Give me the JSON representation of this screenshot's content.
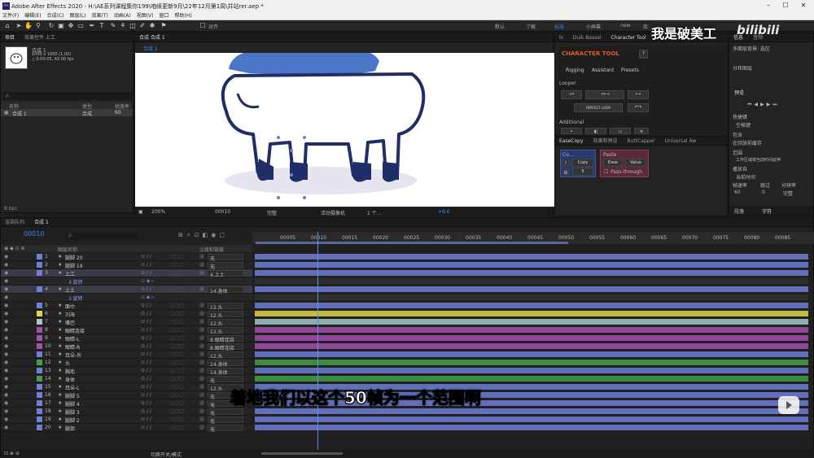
{
  "app": {
    "title": "Adobe After Effects 2020 - H:\\AE系列课程集你199\\咱续更新9月\\22年12月第1周\\并站rer.aep *",
    "logo": "Ae"
  },
  "menu": [
    "文件(F)",
    "编辑(E)",
    "合成(C)",
    "图层(L)",
    "效果(T)",
    "动画(A)",
    "视图(V)",
    "窗口",
    "帮助(H)"
  ],
  "toolbar": {
    "align": "对齐",
    "workspaces": [
      "默认",
      "了解",
      "标准",
      "小屏幕",
      "new",
      "库"
    ],
    "ws_active": "标准"
  },
  "project": {
    "tabs": [
      "项目",
      "效果控件 上工"
    ],
    "comp_name": "合成 1",
    "comp_size": "1000 x 1000 (1.00)",
    "comp_dur": "△ 0:00:05, 60.00 fps",
    "search_placeholder": "ρ.",
    "cols": [
      "名称",
      "类型",
      "帧速率"
    ],
    "item_name": "合成 1",
    "item_type": "合成",
    "item_fps": "60"
  },
  "footer_left": "8 bpc",
  "comp": {
    "tab": "合成 合成 1",
    "sub_tab": "合成 1",
    "zoom": "200%",
    "timecode": "00010",
    "quality": "完整",
    "camera": "活动摄像机",
    "views": "1 个...",
    "exposure": "+0.0"
  },
  "plugins": {
    "tabs": [
      "ls",
      "Duik Bassel",
      "Character Tool"
    ],
    "ct_title": "CHARACTER TOOL",
    "ct_help": "?",
    "ct_tabs": [
      "Rigging",
      "Assistant",
      "Presets"
    ],
    "looper": "Looper",
    "perfect_loop": "PERFECT LOOP",
    "additional": "Additional"
  },
  "easecopy": {
    "tabs": [
      "EaseCopy",
      "效果和预设",
      "ButtCapper",
      "Universal Aw"
    ],
    "copy": "Co...",
    "copy_btn": "Copy",
    "paste": "Paste",
    "ease_btn": "Ease",
    "value_btn": "Value",
    "pass": "Pass-through",
    "num": "5"
  },
  "right_panel": {
    "tabs": [
      "信息",
      "音频"
    ],
    "fields": [
      "多面层背景: 选区",
      "分布图层"
    ],
    "preview": "预览",
    "shortcut": "快捷键",
    "space": "空格键",
    "include": "包含",
    "loop_check": "在回放前缓存",
    "range": "范围",
    "range_val": "工作区域按当前时间延伸",
    "play_from": "播放自",
    "play_val": "当前时间",
    "fps": "帧速率",
    "skip": "跳过",
    "res": "分辨率",
    "fps_val": "60",
    "skip_val": "0",
    "res_val": "完整",
    "bottom_tabs": [
      "段落",
      "字符"
    ]
  },
  "timeline": {
    "tabs": [
      "渲染队列",
      "合成 1"
    ],
    "time": "00010",
    "search_placeholder": "ρ.",
    "col_name": "图层名称",
    "col_parent": "父级和链接",
    "ruler": [
      "00005",
      "00010",
      "00015",
      "00020",
      "00025",
      "00030",
      "00035",
      "00040",
      "00045",
      "00050",
      "00055",
      "00060",
      "00065",
      "00070",
      "00075",
      "00080",
      "00085"
    ],
    "footer": "切换开关/模式"
  },
  "layers": [
    {
      "n": "1",
      "name": "腿脚 20",
      "p": "无",
      "c": "#6f7fd8"
    },
    {
      "n": "2",
      "name": "腿脚 19",
      "p": "无",
      "c": "#6f7fd8"
    },
    {
      "n": "3",
      "name": "上工",
      "p": "4.上土",
      "c": "#6f7fd8",
      "sel": true
    },
    {
      "n": "",
      "name": "ⅱ 旋转",
      "p": "",
      "c": "",
      "fx": true
    },
    {
      "n": "4",
      "name": "上土",
      "p": "14.身体",
      "c": "#6f7fd8",
      "sel": true
    },
    {
      "n": "",
      "name": "ⅱ 旋转",
      "p": "",
      "c": "",
      "fx": true
    },
    {
      "n": "5",
      "name": "面巾",
      "p": "12.头",
      "c": "#6f7fd8"
    },
    {
      "n": "6",
      "name": "刘海",
      "p": "12.头",
      "c": "#e3d34a"
    },
    {
      "n": "7",
      "name": "嘴巴",
      "p": "12.头",
      "c": "#a2c8c8"
    },
    {
      "n": "8",
      "name": "眼睛连接",
      "p": "12.头",
      "c": "#a54fb0"
    },
    {
      "n": "9",
      "name": "眼睛-L",
      "p": "8.眼睛连接",
      "c": "#a54fb0"
    },
    {
      "n": "10",
      "name": "眼睛-R",
      "p": "8.眼睛连接",
      "c": "#a54fb0"
    },
    {
      "n": "11",
      "name": "耳朵-外",
      "p": "12.头",
      "c": "#6f7fd8"
    },
    {
      "n": "12",
      "name": "头",
      "p": "14.身体",
      "c": "#44a04a"
    },
    {
      "n": "13",
      "name": "胸毛",
      "p": "14.身体",
      "c": "#6f7fd8"
    },
    {
      "n": "14",
      "name": "身体",
      "p": "无",
      "c": "#44a04a"
    },
    {
      "n": "15",
      "name": "耳朵-L",
      "p": "12.头",
      "c": "#6f7fd8"
    },
    {
      "n": "16",
      "name": "腿脚 5",
      "p": "无",
      "c": "#6f7fd8"
    },
    {
      "n": "17",
      "name": "腿脚 4",
      "p": "无",
      "c": "#6f7fd8"
    },
    {
      "n": "18",
      "name": "腿脚 3",
      "p": "无",
      "c": "#6f7fd8"
    },
    {
      "n": "19",
      "name": "腿脚 2",
      "p": "无",
      "c": "#6f7fd8"
    },
    {
      "n": "20",
      "name": "腿部",
      "p": "无",
      "c": "#6f7fd8"
    }
  ],
  "overlay": {
    "subtitle": "着地我们以这个50帧为一个范围啊",
    "watermark": "我是破美工",
    "brand": "bilibili"
  },
  "colors": {
    "accent": "#2d8ceb",
    "ct_orange": "#e8552a",
    "layer_blue": "#6f7fd8"
  }
}
